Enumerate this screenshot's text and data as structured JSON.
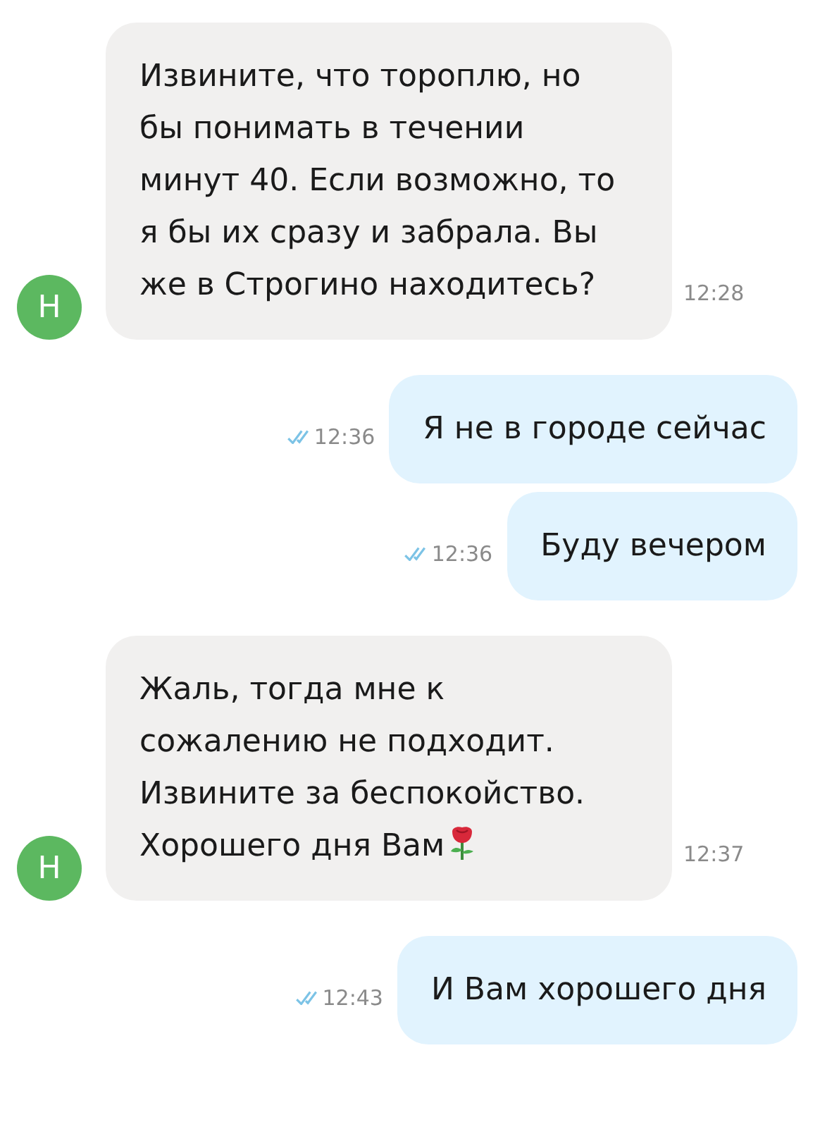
{
  "messages": [
    {
      "kind": "incoming",
      "avatar": "Н",
      "text": "Извините, что тороплю, но\nбы понимать в течении\nминут 40. Если возможно, то\nя бы их сразу и забрала. Вы\nже в Строгино находитесь?",
      "time": "12:28"
    },
    {
      "kind": "outgoing",
      "text": "Я не в городе сейчас",
      "time": "12:36",
      "read": true
    },
    {
      "kind": "outgoing",
      "text": "Буду вечером",
      "time": "12:36",
      "read": true
    },
    {
      "kind": "incoming",
      "avatar": "Н",
      "text": "Жаль, тогда мне к\nсожалению не подходит.\nИзвините за беспокойство.\nХорошего дня Вам",
      "rose": true,
      "time": "12:37"
    },
    {
      "kind": "outgoing",
      "text": "И Вам хорошего дня",
      "time": "12:43",
      "read": true
    }
  ]
}
